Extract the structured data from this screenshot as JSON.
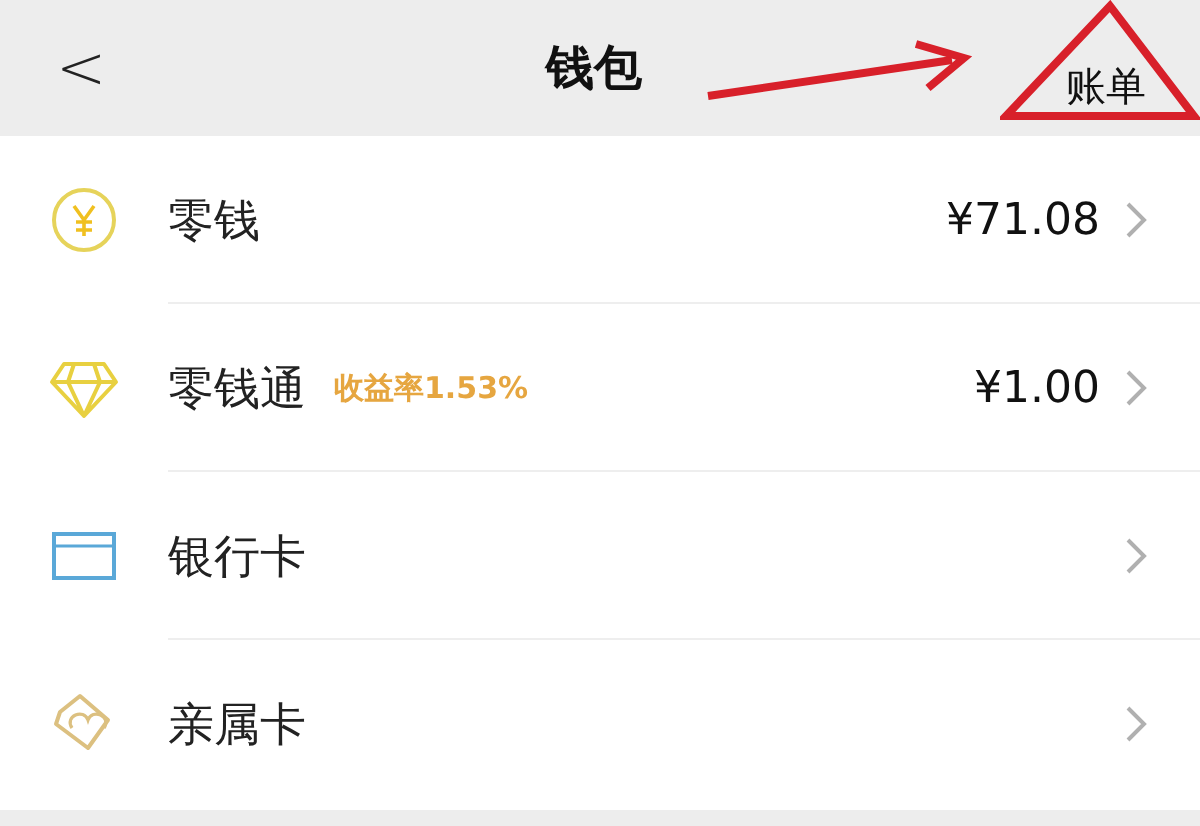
{
  "header": {
    "back": "<",
    "title": "钱包",
    "action": "账单"
  },
  "items": [
    {
      "kind": "coin",
      "label": "零钱",
      "value": "¥71.08"
    },
    {
      "kind": "diamond",
      "label": "零钱通",
      "badge": "收益率1.53%",
      "value": "¥1.00"
    },
    {
      "kind": "card",
      "label": "银行卡"
    },
    {
      "kind": "family",
      "label": "亲属卡"
    }
  ]
}
